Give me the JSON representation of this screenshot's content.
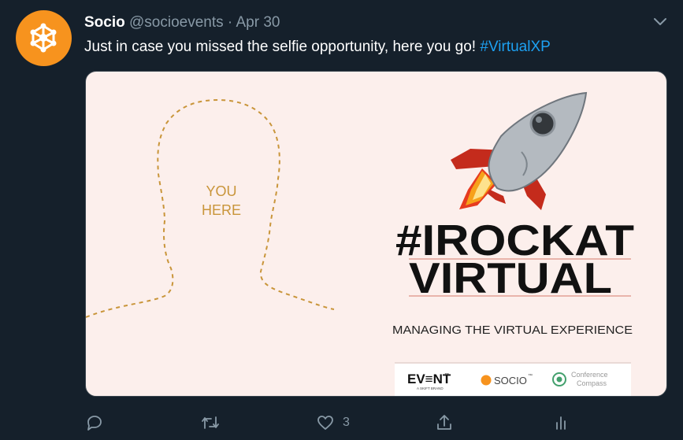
{
  "tweet": {
    "author_name": "Socio",
    "author_handle": "@socioevents",
    "separator": "·",
    "date": "Apr 30",
    "text": "Just in case you missed the selfie opportunity, here you go! ",
    "hashtag": "#VirtualXP"
  },
  "media": {
    "placeholder_line1": "YOU",
    "placeholder_line2": "HERE",
    "campaign_line1": "#IROCKAT",
    "campaign_line2": "VIRTUAL",
    "subtitle": "MANAGING THE VIRTUAL EXPERIENCE",
    "logo_event_main": "EV≡NT",
    "logo_event_tm": "™",
    "logo_event_small": "A SKIFT BRAND",
    "logo_socio": "SOCIO",
    "logo_socio_tm": "™",
    "logo_cc_line1": "Conference",
    "logo_cc_line2": "Compass"
  },
  "actions": {
    "like_count": "3"
  },
  "colors": {
    "background": "#15202b",
    "secondary_text": "#8899a6",
    "link": "#1da1f2",
    "brand_orange": "#f7931e",
    "placeholder_gold": "#c9953a",
    "media_bg": "#fcefec"
  },
  "icons": [
    "socio-logo-icon",
    "chevron-down-icon",
    "reply-icon",
    "retweet-icon",
    "like-icon",
    "share-icon",
    "analytics-icon",
    "rocket-icon"
  ]
}
